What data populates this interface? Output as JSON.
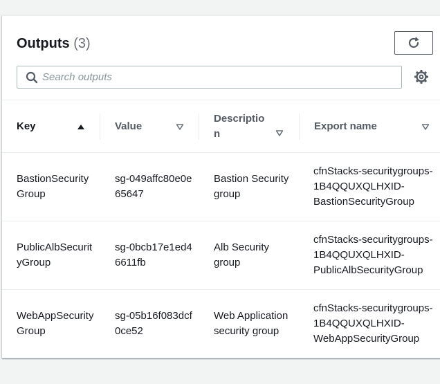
{
  "header": {
    "title": "Outputs",
    "count": "(3)"
  },
  "search": {
    "placeholder": "Search outputs",
    "value": ""
  },
  "icons": {
    "refresh": "refresh-icon",
    "search": "search-icon",
    "settings": "gear-icon",
    "sort_asc": "sort-ascending-icon",
    "sort": "sort-caret-icon"
  },
  "table": {
    "columns": [
      {
        "label": "Key"
      },
      {
        "label": "Value"
      },
      {
        "label": "Description"
      },
      {
        "label": "Export name"
      }
    ],
    "rows": [
      {
        "key": "BastionSecurityGroup",
        "value": "sg-049affc80e0e65647",
        "description": "Bastion Security group",
        "export": "cfnStacks-securitygroups-1B4QQUXQLHXID-BastionSecurityGroup"
      },
      {
        "key": "PublicAlbSecurityGroup",
        "value": "sg-0bcb17e1ed46611fb",
        "description": "Alb Security group",
        "export": "cfnStacks-securitygroups-1B4QQUXQLHXID-PublicAlbSecurityGroup"
      },
      {
        "key": "WebAppSecurityGroup",
        "value": "sg-05b16f083dcf0ce52",
        "description": "Web Application security group",
        "export": "cfnStacks-securitygroups-1B4QQUXQLHXID-WebAppSecurityGroup"
      }
    ]
  },
  "colors": {
    "text": "#16191f",
    "muted": "#687078",
    "border": "#eaeded",
    "icon": "#545b64"
  }
}
